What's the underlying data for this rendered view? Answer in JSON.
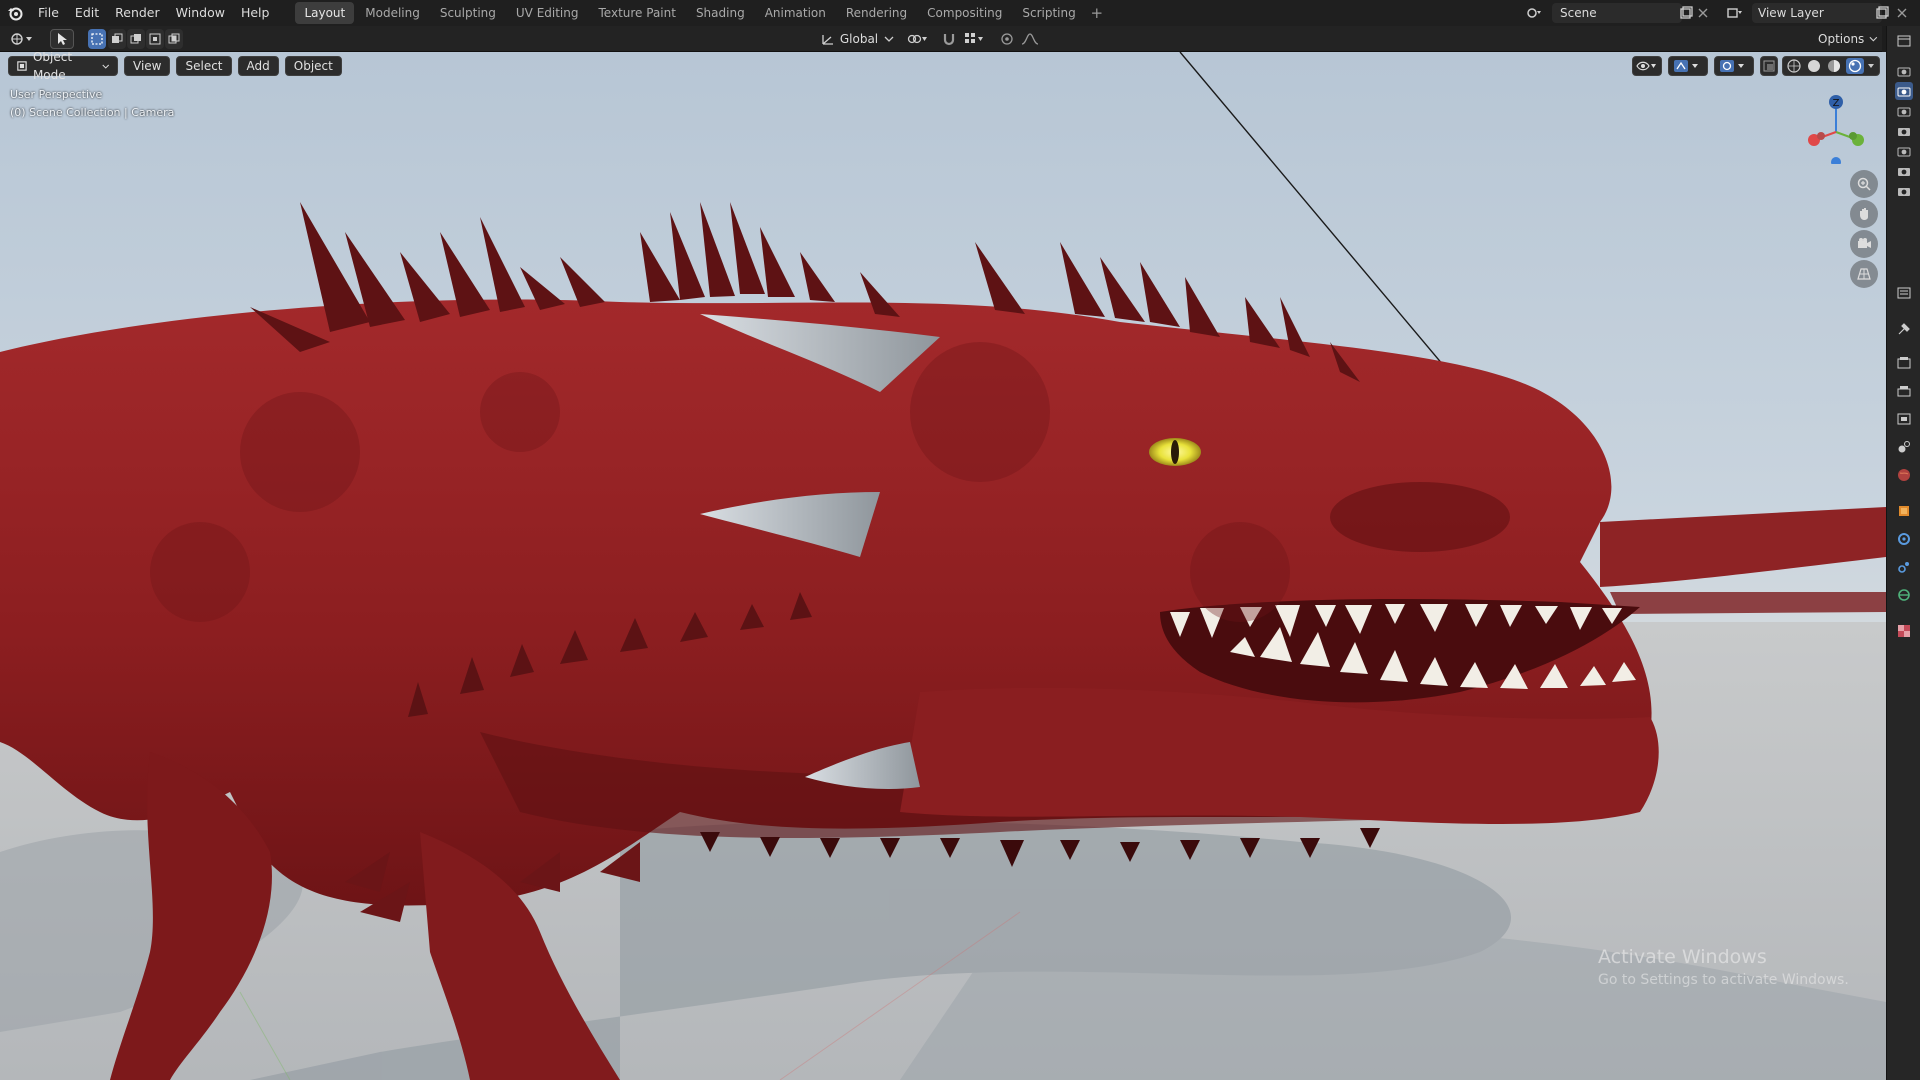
{
  "menu": [
    "File",
    "Edit",
    "Render",
    "Window",
    "Help"
  ],
  "workspaces": {
    "tabs": [
      "Layout",
      "Modeling",
      "Sculpting",
      "UV Editing",
      "Texture Paint",
      "Shading",
      "Animation",
      "Rendering",
      "Compositing",
      "Scripting"
    ],
    "active": "Layout",
    "add_symbol": "+"
  },
  "scene": {
    "name": "Scene"
  },
  "view_layer": {
    "name": "View Layer"
  },
  "toolbar": {
    "transform_orientation": "Global",
    "options_label": "Options"
  },
  "viewport": {
    "mode": "Object Mode",
    "menus": [
      "View",
      "Select",
      "Add",
      "Object"
    ],
    "perspective_label": "User Perspective",
    "collection_label": "(0) Scene Collection | Camera",
    "gizmo_axis_label": "Z",
    "sky_color": "#b8c9d8",
    "ground_color": "#c7c9cb",
    "dragon_color": "#8e1f21"
  },
  "watermark": {
    "title": "Activate Windows",
    "subtitle": "Go to Settings to activate Windows."
  },
  "colors": {
    "accent": "#4772b3",
    "axis_x": "#e04848",
    "axis_y": "#6bb23a",
    "axis_z": "#3b7fd8",
    "dragon_eye": "#e8e23a"
  },
  "icons": {
    "properties_tabs": [
      "tool-icon",
      "render-icon",
      "output-icon",
      "view-layer-icon",
      "scene-icon",
      "world-icon",
      "object-icon",
      "modifier-icon",
      "particles-icon",
      "physics-icon",
      "constraints-icon",
      "data-icon",
      "texture-icon"
    ]
  }
}
